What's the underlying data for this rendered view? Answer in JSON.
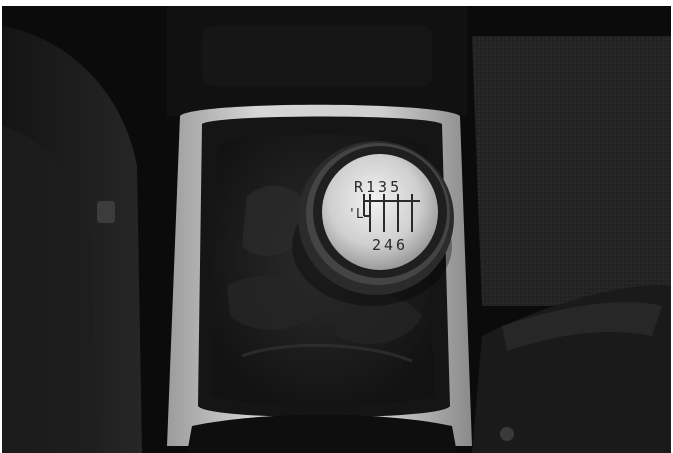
{
  "scene": {
    "subject": "manual-gear-shift-knob",
    "colors": {
      "background": "#0b0b0b",
      "console_trim": "#bdbdbd",
      "boot_leather": "#1e1e1e",
      "knob_face": "#d9d9d9",
      "knob_rim": "#3a3a3a",
      "seat": "#1a1a1a",
      "mat": "#2b2b2b"
    }
  },
  "knob": {
    "top_row": "R135",
    "left_mark": "'L",
    "bottom_row": "246"
  }
}
